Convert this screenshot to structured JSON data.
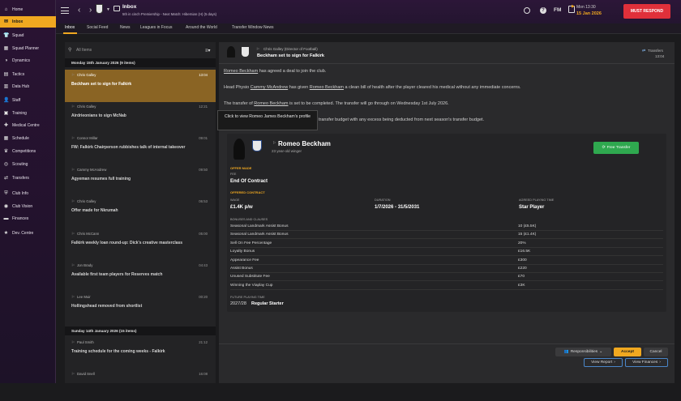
{
  "sidebar": {
    "items": [
      {
        "label": "Home",
        "icon": "home-icon",
        "glyph": "⌂"
      },
      {
        "label": "Inbox",
        "icon": "inbox-icon",
        "glyph": "✉"
      },
      {
        "label": "Squad",
        "icon": "squad-icon",
        "glyph": "👕"
      },
      {
        "label": "Squad Planner",
        "icon": "squad-planner-icon",
        "glyph": "▦"
      },
      {
        "label": "Dynamics",
        "icon": "dynamics-icon",
        "glyph": "◑"
      },
      {
        "label": "Tactics",
        "icon": "tactics-icon",
        "glyph": "▤"
      },
      {
        "label": "Data Hub",
        "icon": "data-hub-icon",
        "glyph": "▥"
      },
      {
        "label": "Staff",
        "icon": "staff-icon",
        "glyph": "👤"
      },
      {
        "label": "Training",
        "icon": "training-icon",
        "glyph": "▣"
      },
      {
        "label": "Medical Centre",
        "icon": "medical-icon",
        "glyph": "✚"
      },
      {
        "label": "Schedule",
        "icon": "schedule-icon",
        "glyph": "▦"
      },
      {
        "label": "Competitions",
        "icon": "competitions-icon",
        "glyph": "♛"
      },
      {
        "label": "Scouting",
        "icon": "scouting-icon",
        "glyph": "◎"
      },
      {
        "label": "Transfers",
        "icon": "transfers-icon",
        "glyph": "⇄"
      },
      {
        "label": "Club Info",
        "icon": "club-info-icon",
        "glyph": "⛨"
      },
      {
        "label": "Club Vision",
        "icon": "club-vision-icon",
        "glyph": "◉"
      },
      {
        "label": "Finances",
        "icon": "finances-icon",
        "glyph": "▬"
      },
      {
        "label": "Dev. Centre",
        "icon": "dev-centre-icon",
        "glyph": "★"
      }
    ]
  },
  "topbar": {
    "title": "Inbox",
    "subtitle": "5th in cinch Premiership - Next Match: Hibernian (H) (5 days)",
    "time": "Mon 13:30",
    "date": "15 Jan 2026",
    "fm_label": "FM",
    "must_respond": "MUST RESPOND"
  },
  "subnav": {
    "tabs": [
      "Inbox",
      "Social Feed",
      "News",
      "Leagues in Focus",
      "Around the World",
      "Transfer Window News"
    ]
  },
  "list": {
    "search_placeholder": "All Items",
    "day1": "Monday 15th January 2026 (9 items)",
    "day2": "Sunday 14th January 2026 (15 items)",
    "items": [
      {
        "sender": "Chris Galley",
        "time": "13:04",
        "subject": "Beckham set to sign for Falkirk"
      },
      {
        "sender": "Chris Galley",
        "time": "12:21",
        "subject": "Airdrieonians to sign McNab"
      },
      {
        "sender": "Connor Millar",
        "time": "09:01",
        "subject": "FW: Falkirk Chairperson rubbishes talk of internal takeover"
      },
      {
        "sender": "Cammy McAndrew",
        "time": "09:50",
        "subject": "Agyeman resumes full training"
      },
      {
        "sender": "Chris Galley",
        "time": "06:53",
        "subject": "Offer made for Nkrumah"
      },
      {
        "sender": "Chris McCann",
        "time": "05:00",
        "subject": "Falkirk weekly loan round-up: Dick's creative masterclass"
      },
      {
        "sender": "Jon Brady",
        "time": "04:43",
        "subject": "Available first team players for Reserves match"
      },
      {
        "sender": "Lee Muir",
        "time": "00:20",
        "subject": "Hollingshead removed from shortlist"
      },
      {
        "sender": "Paul Smith",
        "time": "21:12",
        "subject": "Training schedule for the coming weeks - Falkirk"
      },
      {
        "sender": "David Snell",
        "time": "16:08",
        "subject": ""
      }
    ]
  },
  "message": {
    "sender": "Chris Galley (Director of Football)",
    "subject": "Beckham set to sign for Falkirk",
    "tag": "Transfers",
    "time": "13:04",
    "para1_link": "Romeo Beckham",
    "para1_rest": " has agreed a deal to join the club.",
    "para2_a": "Head Physio ",
    "para2_link1": "Cammy McAndrew",
    "para2_b": " has given ",
    "para2_link2": "Romeo Beckham",
    "para2_c": " a clean bill of health after the player cleared his medical without any immediate concerns.",
    "para3_a": "The transfer of ",
    "para3_link": "Romeo Beckham",
    "para3_b": " is set to be completed. The transfer will go through on Wednesday 1st July 2026.",
    "para4": "transfer budget with any excess being deducted from next season's transfer budget.",
    "tooltip": "Click to view Romeo James Beckham's profile"
  },
  "card": {
    "player_name": "Romeo Beckham",
    "player_desc": "23 year-old winger",
    "transfer_button": "Free Transfer",
    "offer_made": "OFFER MADE",
    "fee_label": "FEE",
    "fee_value": "End Of Contract",
    "offered_contract": "OFFERED CONTRACT",
    "wage_label": "WAGE",
    "wage_value": "£1.4K p/w",
    "duration_label": "DURATION",
    "duration_value": "1/7/2026 - 31/5/2031",
    "playing_time_label": "AGREED PLAYING TIME",
    "playing_time_value": "Star Player",
    "bonuses_label": "BONUSES AND CLAUSES",
    "bonuses": [
      {
        "name": "Seasonal Landmark Assist Bonus",
        "value": "10 (£5.5K)"
      },
      {
        "name": "Seasonal Landmark Assist Bonus",
        "value": "15 (£1.4K)"
      },
      {
        "name": "Sell On Fee Percentage",
        "value": "20%"
      },
      {
        "name": "Loyalty Bonus",
        "value": "£16.5K"
      },
      {
        "name": "Appearance Fee",
        "value": "£300"
      },
      {
        "name": "Assist Bonus",
        "value": "£220"
      },
      {
        "name": "Unused Substitute Fee",
        "value": "£70"
      },
      {
        "name": "Winning the Viaplay Cup",
        "value": "£3K"
      }
    ],
    "future_label": "FUTURE PLAYING TIME",
    "future_season": "2027/28",
    "future_value": "Regular Starter"
  },
  "footer": {
    "responsibilities": "Responsibilities",
    "accept": "Accept",
    "cancel": "Cancel",
    "view_report": "View Report",
    "view_finances": "View Finances"
  },
  "colors": {
    "accent": "#f0a820",
    "must_respond": "#e0303a",
    "free_transfer": "#2fa84f",
    "sidebar": "#2a1333"
  }
}
